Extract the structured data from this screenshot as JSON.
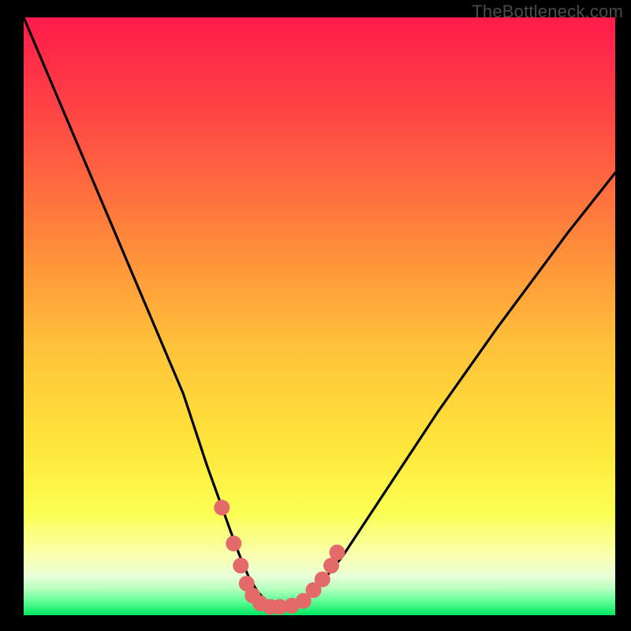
{
  "watermark": "TheBottleneck.com",
  "colors": {
    "frame": "#000000",
    "gradient_top": "#ff1a4b",
    "gradient_mid_upper": "#ff7a3a",
    "gradient_mid": "#ffd83a",
    "gradient_lower": "#faff66",
    "gradient_pale": "#faffcc",
    "gradient_bottom": "#00ff66",
    "curve": "#000000",
    "markers": "#e46a6a"
  },
  "chart_data": {
    "type": "line",
    "title": "",
    "xlabel": "",
    "ylabel": "",
    "xlim": [
      0,
      100
    ],
    "ylim": [
      0,
      100
    ],
    "series": [
      {
        "name": "bottleneck-curve",
        "x": [
          0,
          3,
          6,
          9,
          12,
          15,
          18,
          21,
          24,
          27,
          29,
          31,
          33,
          35,
          36.5,
          38,
          39.5,
          41,
          43,
          45,
          47,
          50,
          54,
          58,
          62,
          66,
          70,
          75,
          80,
          86,
          92,
          100
        ],
        "y": [
          100,
          93,
          86,
          79,
          72,
          65,
          58,
          51,
          44,
          37,
          31,
          25,
          19.5,
          14,
          10,
          6.5,
          4,
          2.3,
          1.4,
          1.4,
          2.3,
          5,
          10,
          16,
          22,
          28,
          34,
          41,
          48,
          56,
          64,
          74
        ]
      }
    ],
    "markers": {
      "name": "highlight-points",
      "points": [
        {
          "x": 33.5,
          "y": 18
        },
        {
          "x": 35.5,
          "y": 12
        },
        {
          "x": 36.7,
          "y": 8.3
        },
        {
          "x": 37.7,
          "y": 5.3
        },
        {
          "x": 38.7,
          "y": 3.3
        },
        {
          "x": 40.0,
          "y": 2.0
        },
        {
          "x": 41.7,
          "y": 1.4
        },
        {
          "x": 43.3,
          "y": 1.4
        },
        {
          "x": 45.3,
          "y": 1.6
        },
        {
          "x": 47.3,
          "y": 2.4
        },
        {
          "x": 49.0,
          "y": 4.2
        },
        {
          "x": 50.5,
          "y": 6.0
        },
        {
          "x": 52.0,
          "y": 8.3
        },
        {
          "x": 53.0,
          "y": 10.5
        }
      ]
    }
  }
}
